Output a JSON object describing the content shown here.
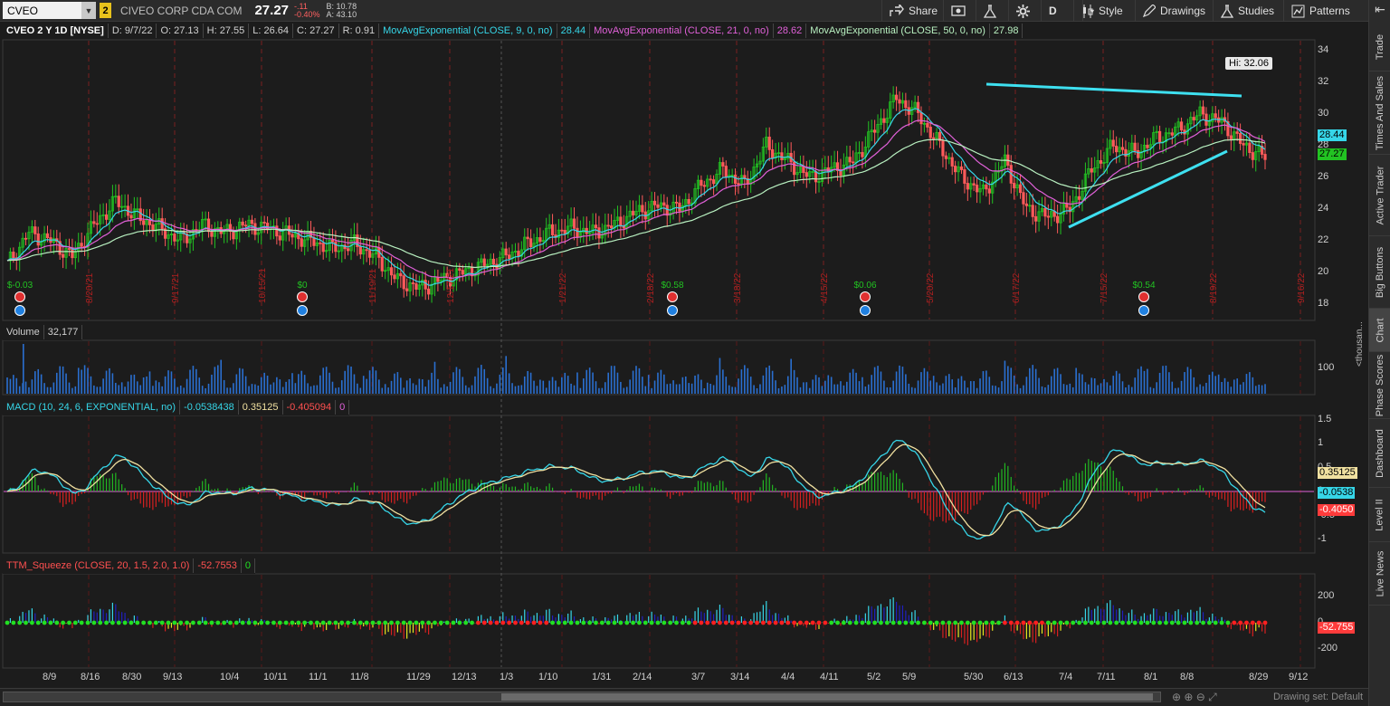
{
  "header": {
    "symbol": "CVEO",
    "badge": "2",
    "company": "CIVEO CORP CDA COM",
    "last": "27.27",
    "change": "-.11",
    "change_pct": "-0.40%",
    "bid": "B: 10.78",
    "ask": "A: 43.10",
    "buttons": [
      {
        "label": "Share",
        "icon": "share-icon"
      },
      {
        "label": "",
        "icon": "flag-icon"
      },
      {
        "label": "",
        "icon": "flask-icon"
      },
      {
        "label": "",
        "icon": "gear-icon"
      },
      {
        "label": "D",
        "icon": ""
      },
      {
        "label": "",
        "icon": "candle-icon"
      },
      {
        "label": "Style",
        "icon": "chevron-down-icon"
      },
      {
        "label": "Drawings",
        "icon": "pencil-icon"
      },
      {
        "label": "Studies",
        "icon": "flask-icon"
      },
      {
        "label": "Patterns",
        "icon": "patterns-icon"
      }
    ]
  },
  "studies_bar": {
    "title": "CVEO 2 Y 1D [NYSE]",
    "date": "D: 9/7/22",
    "open": "O: 27.13",
    "high": "H: 27.55",
    "low": "L: 26.64",
    "close": "C: 27.27",
    "range": "R: 0.91",
    "ema9": "MovAvgExponential (CLOSE, 9, 0, no)",
    "ema9_val": "28.44",
    "ema21": "MovAvgExponential (CLOSE, 21, 0, no)",
    "ema21_val": "28.62",
    "ema50": "MovAvgExponential (CLOSE, 50, 0, no)",
    "ema50_val": "27.98"
  },
  "price_panel": {
    "hi_label": "Hi: 32.06",
    "ema9_tag": "28.44",
    "last_tag": "27.27",
    "y_ticks": [
      "34",
      "32",
      "30",
      "28",
      "26",
      "24",
      "22",
      "20",
      "18"
    ],
    "dividends": [
      "$-0.03",
      "$0",
      "$0.58",
      "$0.06",
      "$0.54"
    ],
    "month_marks": [
      "8/20/21",
      "9/17/21",
      "10/15/21",
      "11/19/21",
      "12/17/21",
      "1/21/22",
      "2/18/22",
      "3/18/22",
      "4/15/22",
      "5/20/22",
      "6/17/22",
      "7/15/22",
      "8/19/22",
      "9/16/22"
    ],
    "colors": {
      "up": "#22c322",
      "down": "#ff5a5a",
      "ema9": "#36d6e8",
      "ema21": "#e060d8",
      "ema50": "#b8f0c0",
      "trendline": "#3ee0f0"
    }
  },
  "volume_panel": {
    "title": "Volume",
    "value": "32,177",
    "y_tick": "100",
    "unit": "<thousan..."
  },
  "macd_panel": {
    "title": "MACD (10, 24, 6, EXPONENTIAL, no)",
    "value": "-0.0538438",
    "avg": "0.35125",
    "diff": "-0.405094",
    "zero": "0",
    "y_ticks": [
      "1.5",
      "1",
      "0.5",
      "0",
      "-0.5",
      "-1"
    ],
    "tag_avg": "0.35125",
    "tag_value": "-0.0538",
    "tag_diff": "-0.4050"
  },
  "ttm_panel": {
    "title": "TTM_Squeeze (CLOSE, 20, 1.5, 2.0, 1.0)",
    "value": "-52.7553",
    "squeeze": "0",
    "y_ticks": [
      "200",
      "0",
      "-200"
    ],
    "tag_value": "-52.755"
  },
  "x_axis": [
    "8/9",
    "8/16",
    "8/30",
    "9/13",
    "10/4",
    "10/11",
    "11/1",
    "11/8",
    "11/29",
    "12/13",
    "1/3",
    "1/10",
    "1/31",
    "2/14",
    "3/7",
    "3/14",
    "4/4",
    "4/11",
    "5/2",
    "5/9",
    "5/30",
    "6/13",
    "7/4",
    "7/11",
    "8/1",
    "8/8",
    "8/29",
    "9/12"
  ],
  "right_tabs": [
    "Trade",
    "Times And Sales",
    "Active Trader",
    "Big Buttons",
    "Chart",
    "Phase Scores",
    "Dashboard",
    "Level II",
    "Live News"
  ],
  "bottom": {
    "drawing_set": "Drawing set: Default"
  },
  "chart_data": {
    "type": "candlestick",
    "title": "CVEO 2 Y 1D [NYSE]",
    "ylim": [
      17,
      35
    ],
    "series": [
      {
        "name": "MovAvgExponential (CLOSE, 9, 0, no)",
        "last": 28.44
      },
      {
        "name": "MovAvgExponential (CLOSE, 21, 0, no)",
        "last": 28.62
      },
      {
        "name": "MovAvgExponential (CLOSE, 50, 0, no)",
        "last": 27.98
      }
    ],
    "weekly_close_approx": [
      20.5,
      22.5,
      22,
      21,
      23,
      24.5,
      23.5,
      22.8,
      22,
      23,
      22.5,
      23,
      22.8,
      22.4,
      22,
      21.5,
      21.8,
      21,
      19.5,
      19,
      19.5,
      20,
      20.5,
      21,
      21.8,
      22.5,
      22.8,
      22.5,
      23,
      23.8,
      24.2,
      24,
      25.5,
      26.5,
      25.5,
      28,
      27,
      26,
      26.5,
      27,
      29,
      31,
      30,
      28,
      26,
      25,
      27,
      24,
      23.5,
      24,
      26.5,
      28,
      27.5,
      28.5,
      29,
      30,
      29.5,
      28,
      27.27
    ]
  }
}
